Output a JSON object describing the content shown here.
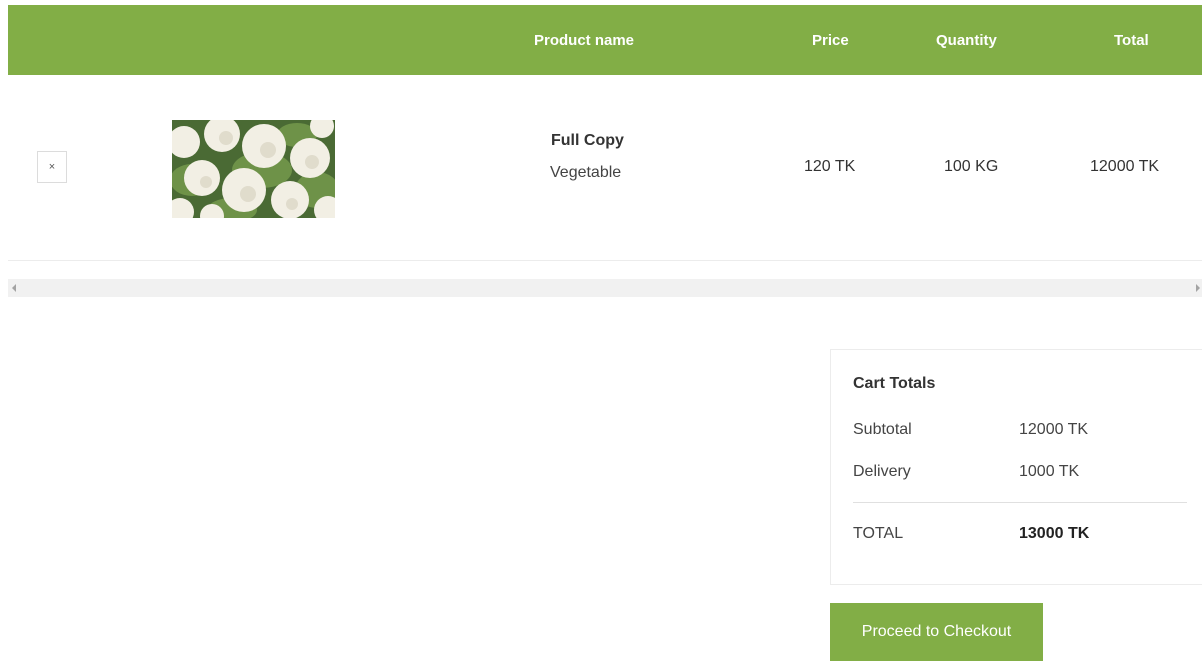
{
  "table": {
    "headers": {
      "product_name": "Product name",
      "price": "Price",
      "quantity": "Quantity",
      "total": "Total"
    },
    "rows": [
      {
        "remove_label": "×",
        "image_icon": "cauliflower-product-image",
        "name": "Full Copy",
        "category": "Vegetable",
        "price": "120 TK",
        "quantity": "100 KG",
        "total": "12000 TK"
      }
    ]
  },
  "cart_totals": {
    "title": "Cart Totals",
    "subtotal_label": "Subtotal",
    "subtotal_value": "12000 TK",
    "delivery_label": "Delivery",
    "delivery_value": "1000 TK",
    "total_label": "TOTAL",
    "total_value": "13000 TK"
  },
  "checkout_button": "Proceed to Checkout",
  "colors": {
    "accent": "#82ae46"
  }
}
